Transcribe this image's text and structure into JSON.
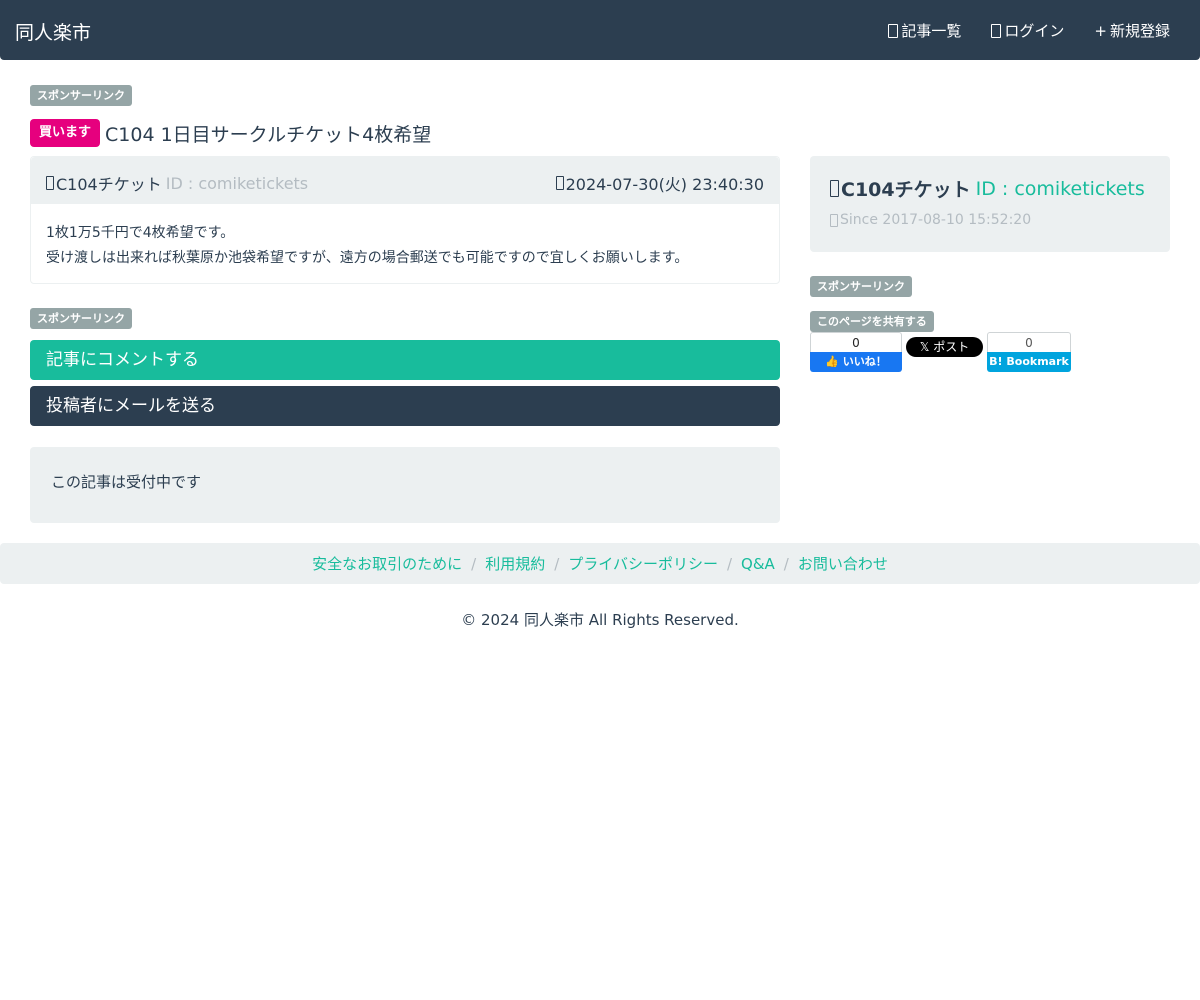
{
  "navbar": {
    "brand": "同人楽市",
    "links": [
      {
        "label": "記事一覧",
        "icon": "list-icon"
      },
      {
        "label": "ログイン",
        "icon": "login-icon"
      },
      {
        "label": "新規登録",
        "icon": "plus-icon"
      }
    ]
  },
  "sponsor_label": "スポンサーリンク",
  "article": {
    "type_badge": "買います",
    "title": "C104 1日目サークルチケット4枚希望",
    "author_name": "C104チケット",
    "author_id": "ID : comiketickets",
    "date": "2024-07-30(火) 23:40:30",
    "body_lines": [
      "1枚1万5千円で4枚希望です。",
      "受け渡しは出来れば秋葉原か池袋希望ですが、遠方の場合郵送でも可能ですので宜しくお願いします。"
    ]
  },
  "actions": {
    "comment_label": "記事にコメントする",
    "mail_label": "投稿者にメールを送る"
  },
  "status": "この記事は受付中です",
  "profile": {
    "name": "C104チケット",
    "id": "ID : comiketickets",
    "since": "Since 2017-08-10 15:52:20"
  },
  "share": {
    "label": "このページを共有する",
    "facebook_count": "0",
    "facebook_label": "いいね！",
    "x_label": "ポスト",
    "hatena_count": "0",
    "hatena_label": "Bookmark"
  },
  "footer": {
    "links": [
      "安全なお取引のために",
      "利用規約",
      "プライバシーポリシー",
      "Q&A",
      "お問い合わせ"
    ],
    "copyright": "© 2024 同人楽市 All Rights Reserved."
  },
  "colors": {
    "navbar": "#2c3e50",
    "accent": "#18bc9c",
    "buy_badge": "#e6007e",
    "sponsor_badge": "#95a5a6",
    "well": "#ecf0f1"
  }
}
